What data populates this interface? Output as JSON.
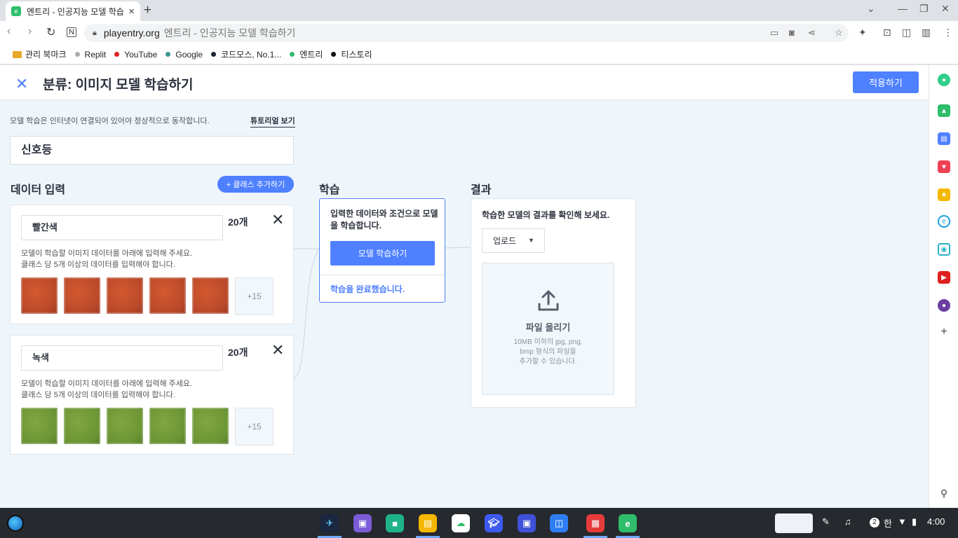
{
  "browser": {
    "tab_title": "엔트리 - 인공지능 모델 학습하",
    "tab_favicon": "e",
    "url_host": "playentry.org",
    "url_rest": "엔트리 - 인공지능 모델 학습하기"
  },
  "bookmarks": [
    {
      "label": "관리 북마크",
      "color": "#e8a82a",
      "type": "folder"
    },
    {
      "label": "Replit",
      "color": "#aaaaaa",
      "type": "dot"
    },
    {
      "label": "YouTube",
      "color": "#e02020",
      "type": "dot"
    },
    {
      "label": "Google",
      "color": "#3a9a8a",
      "type": "dot"
    },
    {
      "label": "코드모스, No.1...",
      "color": "#1a2233",
      "type": "dot"
    },
    {
      "label": "엔트리",
      "color": "#2fbd6b",
      "type": "dot"
    },
    {
      "label": "티스토리",
      "color": "#111111",
      "type": "dot"
    }
  ],
  "header": {
    "title": "분류: 이미지 모델 학습하기",
    "apply_label": "적용하기"
  },
  "notice": "모델 학습은 인터넷이 연결되어 있어야 정상적으로 동작합니다.",
  "tutorial_label": "튜토리얼 보기",
  "model_name": "신호등",
  "data_input": {
    "heading": "데이터 입력",
    "add_class_label": "+ 클래스 추가하기",
    "classes": [
      {
        "name": "빨간색",
        "count": "20개",
        "help_line1": "모델이 학습할 이미지 데이터를 아래에 입력해 주세요.",
        "help_line2": "클래스 당 5개 이상의 데이터를 입력해야 합니다.",
        "more": "+15",
        "color": "red"
      },
      {
        "name": "녹색",
        "count": "20개",
        "help_line1": "모델이 학습할 이미지 데이터를 아래에 입력해 주세요.",
        "help_line2": "클래스 당 5개 이상의 데이터를 입력해야 합니다.",
        "more": "+15",
        "color": "green"
      }
    ]
  },
  "training": {
    "heading": "학습",
    "description": "입력한 데이터와 조건으로 모델을 학습합니다.",
    "button_label": "모델 학습하기",
    "status": "학습을 완료했습니다."
  },
  "result": {
    "heading": "결과",
    "description": "학습한 모델의 결과를 확인해 보세요.",
    "select_value": "업로드",
    "upload_title": "파일 올리기",
    "upload_help1": "10MB 이하의 jpg, png,",
    "upload_help2": "bmp 형식의 파일을",
    "upload_help3": "추가할 수 있습니다."
  },
  "taskbar": {
    "clock": "4:00",
    "badge": "2",
    "ime": "한"
  },
  "colors": {
    "accent": "#4f80ff",
    "background": "#eef6fc"
  }
}
